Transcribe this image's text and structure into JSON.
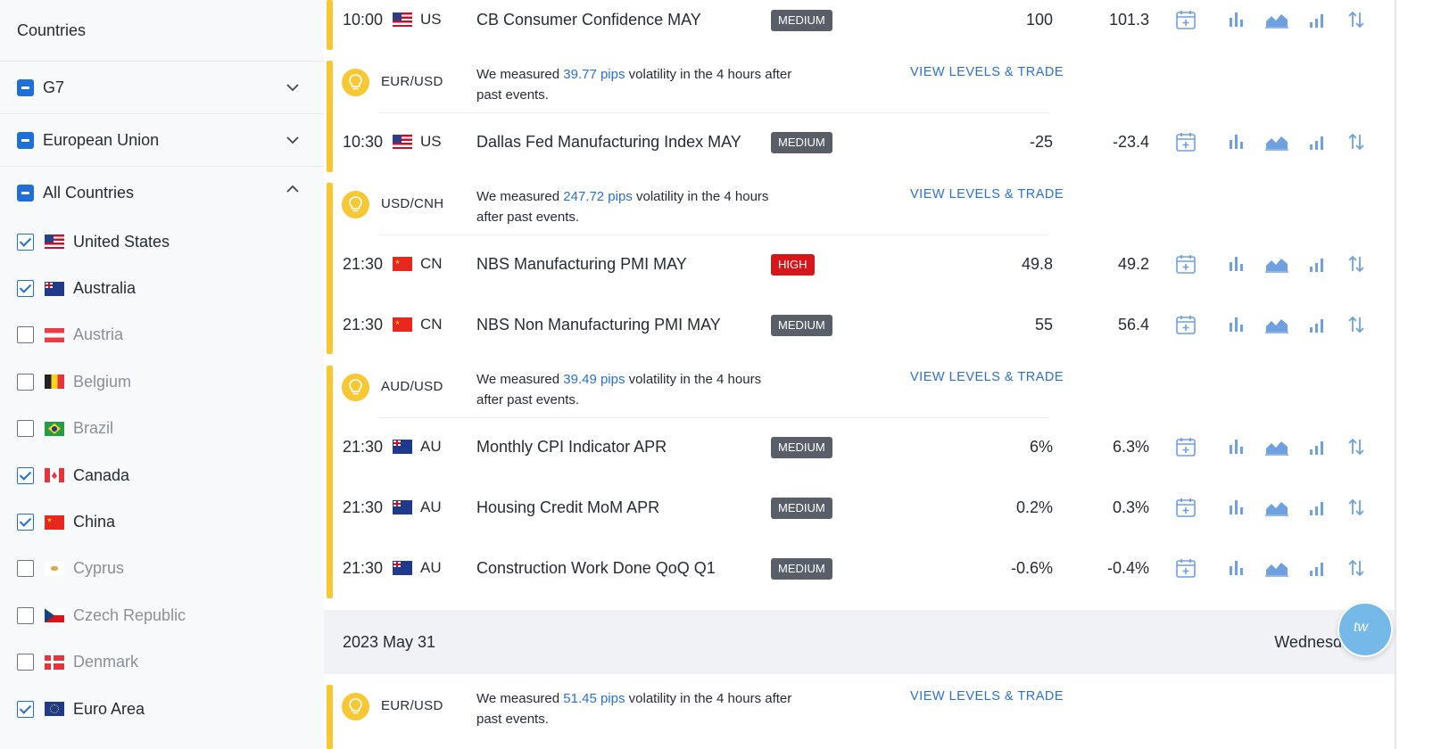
{
  "sidebar": {
    "title": "Countries",
    "groups": [
      {
        "label": "G7",
        "expanded": false
      },
      {
        "label": "European Union",
        "expanded": false
      },
      {
        "label": "All Countries",
        "expanded": true
      }
    ],
    "countries": [
      {
        "label": "United States",
        "checked": true
      },
      {
        "label": "Australia",
        "checked": true
      },
      {
        "label": "Austria",
        "checked": false
      },
      {
        "label": "Belgium",
        "checked": false
      },
      {
        "label": "Brazil",
        "checked": false
      },
      {
        "label": "Canada",
        "checked": true
      },
      {
        "label": "China",
        "checked": true
      },
      {
        "label": "Cyprus",
        "checked": false
      },
      {
        "label": "Czech Republic",
        "checked": false
      },
      {
        "label": "Denmark",
        "checked": false
      },
      {
        "label": "Euro Area",
        "checked": true
      }
    ]
  },
  "events": [
    {
      "time": "10:00",
      "country": "US",
      "name": "CB Consumer Confidence MAY",
      "importance": "MEDIUM",
      "actual": "100",
      "forecast": "101.3"
    },
    {
      "time": "10:30",
      "country": "US",
      "name": "Dallas Fed Manufacturing Index MAY",
      "importance": "MEDIUM",
      "actual": "-25",
      "forecast": "-23.4"
    },
    {
      "time": "21:30",
      "country": "CN",
      "name": "NBS Manufacturing PMI MAY",
      "importance": "HIGH",
      "actual": "49.8",
      "forecast": "49.2"
    },
    {
      "time": "21:30",
      "country": "CN",
      "name": "NBS Non Manufacturing PMI MAY",
      "importance": "MEDIUM",
      "actual": "55",
      "forecast": "56.4"
    },
    {
      "time": "21:30",
      "country": "AU",
      "name": "Monthly CPI Indicator APR",
      "importance": "MEDIUM",
      "actual": "6%",
      "forecast": "6.3%"
    },
    {
      "time": "21:30",
      "country": "AU",
      "name": "Housing Credit MoM APR",
      "importance": "MEDIUM",
      "actual": "0.2%",
      "forecast": "0.3%"
    },
    {
      "time": "21:30",
      "country": "AU",
      "name": "Construction Work Done QoQ Q1",
      "importance": "MEDIUM",
      "actual": "-0.6%",
      "forecast": "-0.4%"
    }
  ],
  "volatility": [
    {
      "pair": "EUR/USD",
      "prefix": "We measured ",
      "pips": "39.77 pips",
      "suffix_line1": " volatility in the 4 hours after",
      "suffix_line2": "past events.",
      "link": "VIEW LEVELS & TRADE"
    },
    {
      "pair": "USD/CNH",
      "prefix": "We measured ",
      "pips": "247.72 pips",
      "suffix_line1": " volatility in the 4 hours",
      "suffix_line2": "after past events.",
      "link": "VIEW LEVELS & TRADE"
    },
    {
      "pair": "AUD/USD",
      "prefix": "We measured ",
      "pips": "39.49 pips",
      "suffix_line1": " volatility in the 4 hours",
      "suffix_line2": "after past events.",
      "link": "VIEW LEVELS & TRADE"
    },
    {
      "pair": "EUR/USD",
      "prefix": "We measured ",
      "pips": "51.45 pips",
      "suffix_line1": " volatility in the 4 hours after",
      "suffix_line2": "past events.",
      "link": "VIEW LEVELS & TRADE"
    }
  ],
  "date_header": {
    "date": "2023 May 31",
    "weekday": "Wednesday"
  },
  "chat": {
    "label": "tw"
  },
  "colors": {
    "accent": "#1f6fd8",
    "link": "#2a6fd6",
    "highlight": "#f7c833",
    "high": "#d9141b",
    "medium": "#595f69"
  }
}
